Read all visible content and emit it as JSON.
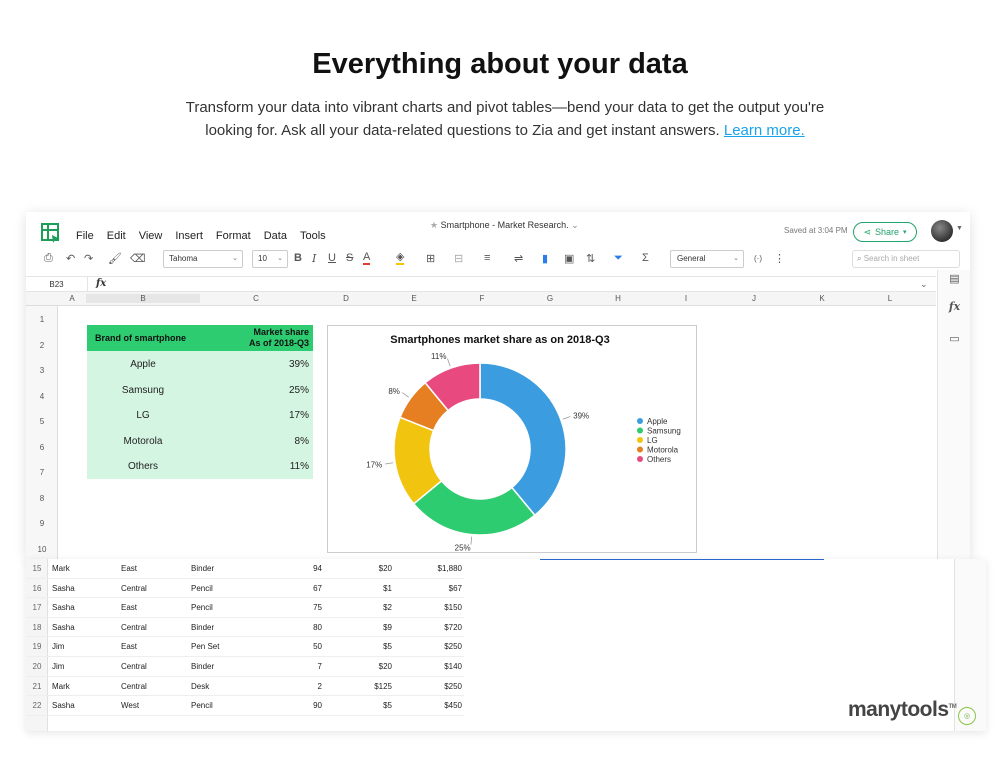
{
  "hero": {
    "title": "Everything about your data",
    "body": "Transform your data into vibrant charts and pivot tables—bend your data to get the output you're looking for. Ask all your data-related questions to Zia and get instant answers.",
    "link": "Learn more."
  },
  "app": {
    "menu": [
      "File",
      "Edit",
      "View",
      "Insert",
      "Format",
      "Data",
      "Tools"
    ],
    "doc_title": "Smartphone - Market Research.",
    "saved": "Saved at 3:04 PM",
    "share": "Share",
    "font": "Tahoma",
    "font_size": "10",
    "number_format": "General",
    "search_placeholder": "Search in sheet",
    "cell_ref": "B23",
    "fx": "fx"
  },
  "grid": {
    "columns": [
      "A",
      "B",
      "C",
      "D",
      "E",
      "F",
      "G",
      "H",
      "I",
      "J",
      "K",
      "L"
    ],
    "rows": [
      "1",
      "2",
      "3",
      "4",
      "5",
      "6",
      "7",
      "8",
      "9",
      "10"
    ]
  },
  "brand_table": {
    "header_brand": "Brand of smartphone",
    "header_share_1": "Market share",
    "header_share_2": "As of 2018-Q3",
    "rows": [
      {
        "brand": "Apple",
        "share": "39%"
      },
      {
        "brand": "Samsung",
        "share": "25%"
      },
      {
        "brand": "LG",
        "share": "17%"
      },
      {
        "brand": "Motorola",
        "share": "8%"
      },
      {
        "brand": "Others",
        "share": "11%"
      }
    ]
  },
  "chart_data": {
    "type": "pie",
    "title": "Smartphones market share as on 2018-Q3",
    "categories": [
      "Apple",
      "Samsung",
      "LG",
      "Motorola",
      "Others"
    ],
    "values": [
      39,
      25,
      17,
      8,
      11
    ],
    "labels": [
      "39%",
      "25%",
      "17%",
      "8%",
      "11%"
    ],
    "colors": [
      "#3b9de0",
      "#2ecc71",
      "#f1c40f",
      "#e67e22",
      "#e84a7f"
    ],
    "donut": true,
    "legend": "right"
  },
  "lower_rows": [
    {
      "num": "15",
      "name": "Mark",
      "region": "East",
      "item": "Binder",
      "units": "94",
      "cost": "$20",
      "total": "$1,880"
    },
    {
      "num": "16",
      "name": "Sasha",
      "region": "Central",
      "item": "Pencil",
      "units": "67",
      "cost": "$1",
      "total": "$67"
    },
    {
      "num": "17",
      "name": "Sasha",
      "region": "East",
      "item": "Pencil",
      "units": "75",
      "cost": "$2",
      "total": "$150"
    },
    {
      "num": "18",
      "name": "Sasha",
      "region": "Central",
      "item": "Binder",
      "units": "80",
      "cost": "$9",
      "total": "$720"
    },
    {
      "num": "19",
      "name": "Jim",
      "region": "East",
      "item": "Pen Set",
      "units": "50",
      "cost": "$5",
      "total": "$250"
    },
    {
      "num": "20",
      "name": "Jim",
      "region": "Central",
      "item": "Binder",
      "units": "7",
      "cost": "$20",
      "total": "$140"
    },
    {
      "num": "21",
      "name": "Mark",
      "region": "Central",
      "item": "Desk",
      "units": "2",
      "cost": "$125",
      "total": "$250"
    },
    {
      "num": "22",
      "name": "Sasha",
      "region": "West",
      "item": "Pencil",
      "units": "90",
      "cost": "$5",
      "total": "$450"
    }
  ],
  "watermark": {
    "text": "manytools",
    "tm": "TM"
  }
}
